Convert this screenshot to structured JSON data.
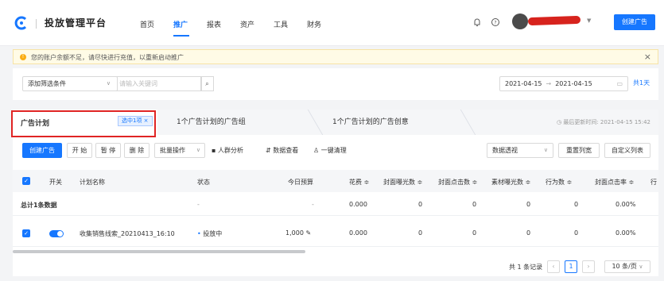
{
  "header": {
    "app_title": "投放管理平台",
    "nav": [
      "首页",
      "推广",
      "报表",
      "资产",
      "工具",
      "财务"
    ],
    "active_nav": "推广",
    "create_button": "创建广告"
  },
  "alert": {
    "text": "您的账户余额不足，请尽快进行充值，以重新启动推广"
  },
  "filter": {
    "add_filter_label": "添加筛选条件",
    "keyword_placeholder": "请输入关键词",
    "date_start": "2021-04-15",
    "date_end": "2021-04-15",
    "days_label": "共1天"
  },
  "tabs": {
    "plan": "广告计划",
    "selected_badge": "选中1项 ×",
    "group": "1个广告计划的广告组",
    "creative": "1个广告计划的广告创意",
    "updated_label": "最后更新时间: 2021-04-15 15:42"
  },
  "toolbar": {
    "create": "创建广告",
    "start": "开 始",
    "pause": "暂 停",
    "delete": "删 除",
    "batch": "批量操作",
    "crowd": "人群分析",
    "data_view": "数据查看",
    "clear": "一键清理",
    "pivot": "数据透视",
    "reset_cols": "重置列宽",
    "custom_cols": "自定义列表"
  },
  "table": {
    "headers": [
      "开关",
      "计划名称",
      "状态",
      "今日预算",
      "花费 ≑",
      "封面曝光数 ≑",
      "封面点击数 ≑",
      "素材曝光数 ≑",
      "行为数 ≑",
      "封面点击率 ≑",
      "行"
    ],
    "total_label": "总计1条数据",
    "total_row": {
      "status": "-",
      "budget": "-",
      "cost": "0.000",
      "cover_exposure": "0",
      "cover_clicks": "0",
      "material_exposure": "0",
      "actions": "0",
      "ctr": "0.00%"
    },
    "rows": [
      {
        "name": "收集销售线索_20210413_16:10",
        "status": "投放中",
        "budget": "1,000",
        "cost": "0.000",
        "cover_exposure": "0",
        "cover_clicks": "0",
        "material_exposure": "0",
        "actions": "0",
        "ctr": "0.00%"
      }
    ]
  },
  "pager": {
    "total": "共 1 条记录",
    "current": "1",
    "page_size": "10 条/页"
  },
  "colors": {
    "primary": "#1677ff",
    "alert_bg": "#fffbe6",
    "highlight": "#e02424"
  }
}
